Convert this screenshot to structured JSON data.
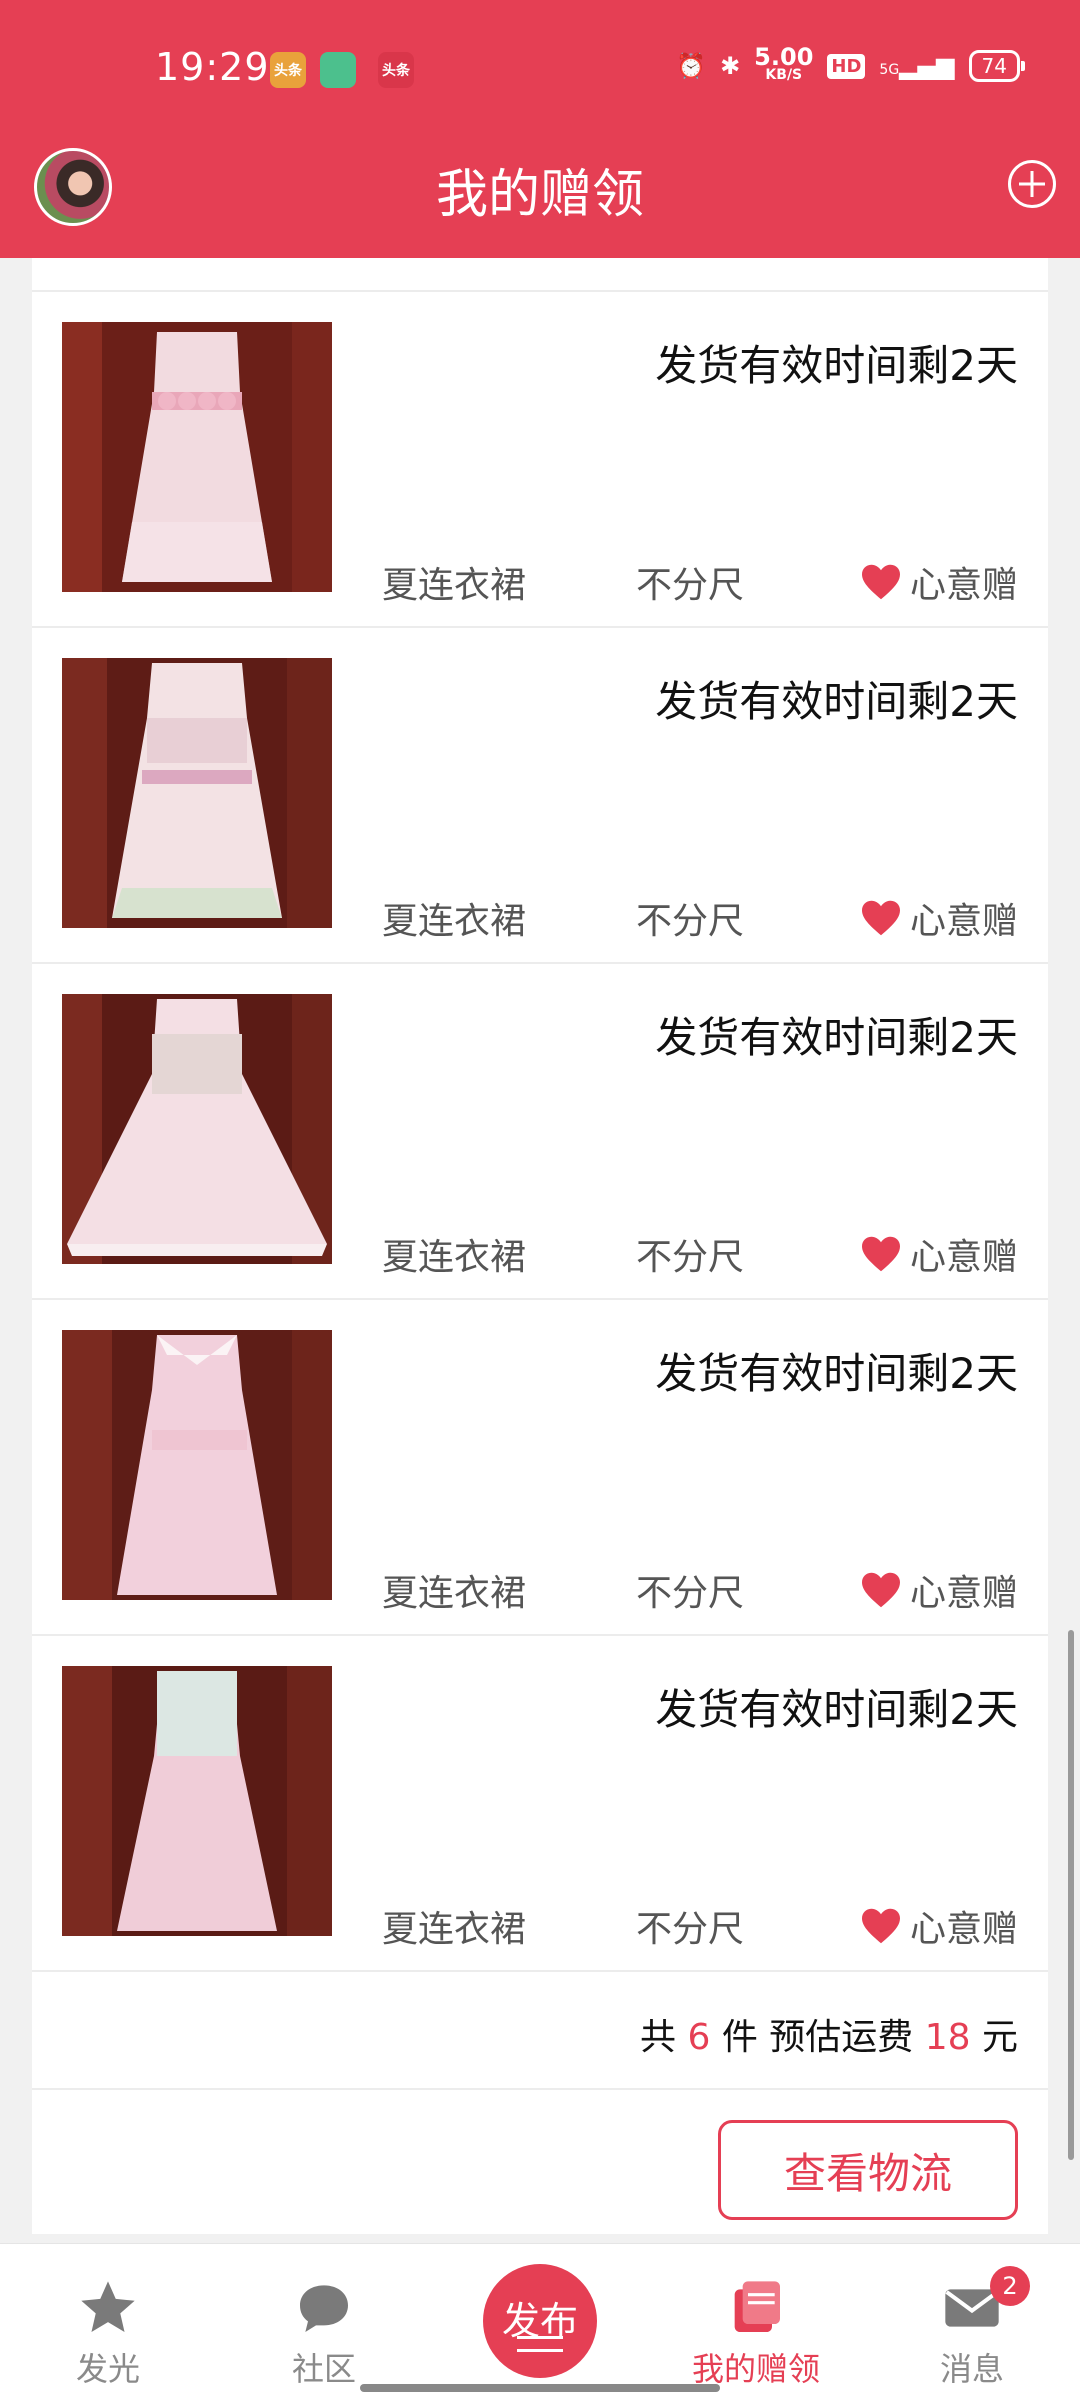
{
  "status_bar": {
    "time": "19:29",
    "app_icons": [
      "头条",
      "",
      "头条"
    ],
    "net_speed_value": "5.00",
    "net_speed_unit": "KB/S",
    "hd": "HD",
    "signal": "5G",
    "battery": "74"
  },
  "header": {
    "title": "我的赠领"
  },
  "items": [
    {
      "deadline": "发货有效时间剩2天",
      "name": "夏连衣裙",
      "size": "不分尺",
      "type": "心意赠"
    },
    {
      "deadline": "发货有效时间剩2天",
      "name": "夏连衣裙",
      "size": "不分尺",
      "type": "心意赠"
    },
    {
      "deadline": "发货有效时间剩2天",
      "name": "夏连衣裙",
      "size": "不分尺",
      "type": "心意赠"
    },
    {
      "deadline": "发货有效时间剩2天",
      "name": "夏连衣裙",
      "size": "不分尺",
      "type": "心意赠"
    },
    {
      "deadline": "发货有效时间剩2天",
      "name": "夏连衣裙",
      "size": "不分尺",
      "type": "心意赠"
    }
  ],
  "summary": {
    "prefix": "共",
    "count": "6",
    "mid": "件 预估运费",
    "fee": "18",
    "suffix": "元"
  },
  "logistics_button": "查看物流",
  "nav": {
    "items": [
      "发光",
      "社区",
      "发布",
      "我的赠领",
      "消息"
    ],
    "badge": "2"
  },
  "colors": {
    "accent": "#e53f54"
  }
}
